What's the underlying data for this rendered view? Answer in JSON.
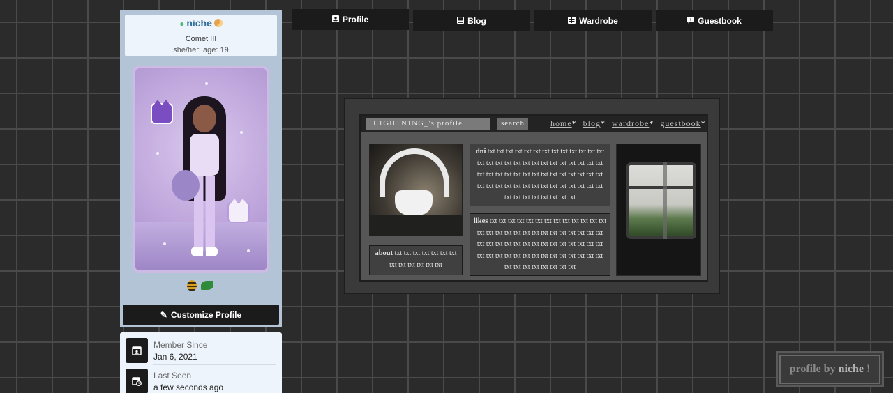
{
  "user": {
    "name": "niche",
    "level": "Comet III",
    "pronouns_age": "she/her; age: 19",
    "status_color": "#4bbf73"
  },
  "tabs": [
    {
      "label": "Profile",
      "icon": "id-card-icon"
    },
    {
      "label": "Blog",
      "icon": "blog-icon"
    },
    {
      "label": "Wardrobe",
      "icon": "wardrobe-icon"
    },
    {
      "label": "Guestbook",
      "icon": "guestbook-icon"
    }
  ],
  "customize_label": "Customize Profile",
  "stats": {
    "member_since_label": "Member Since",
    "member_since_value": "Jan 6, 2021",
    "last_seen_label": "Last Seen",
    "last_seen_value": "a few seconds ago"
  },
  "profile_widget": {
    "name_field": "L1GHTN1NG_'s profile",
    "search_label": "search",
    "nav": [
      "home",
      "blog",
      "wardrobe",
      "guestbook"
    ],
    "nav_suffix": "*",
    "dni_title": "dni",
    "dni_text": "txt txt txt txt txt txt txt txt txt txt txt txt txt txt txt txt txt txt txt txt txt txt txt txt txt txt txt txt txt txt txt txt txt txt txt txt txt txt txt txt txt txt txt txt txt txt txt txt txt txt txt txt txt txt txt txt txt txt txt txt txt txt txt",
    "likes_title": "likes",
    "likes_text": "txt txt txt txt txt txt txt txt txt txt txt txt txt txt txt txt txt txt txt txt txt txt txt txt txt txt txt txt txt txt txt txt txt txt txt txt txt txt txt txt txt txt txt txt txt txt txt txt txt txt txt txt txt txt txt txt txt txt txt txt txt txt txt",
    "about_title": "about",
    "about_text": "txt txt txt txt txt txt txt txt txt txt txt txt txt"
  },
  "credit": {
    "prefix": "profile by",
    "link": "niche",
    "suffix": "!"
  }
}
